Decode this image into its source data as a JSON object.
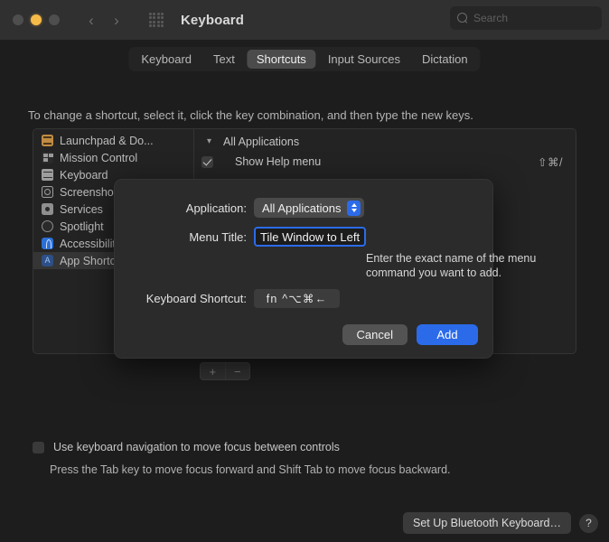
{
  "window": {
    "title": "Keyboard",
    "traffic_lights": [
      "close",
      "minimize",
      "zoom"
    ],
    "nav_back": "‹",
    "nav_forward": "›",
    "grid_icon": "grid-icon"
  },
  "search": {
    "placeholder": "Search",
    "value": "",
    "icon": "search-icon"
  },
  "tabs": [
    {
      "label": "Keyboard",
      "selected": false
    },
    {
      "label": "Text",
      "selected": false
    },
    {
      "label": "Shortcuts",
      "selected": true
    },
    {
      "label": "Input Sources",
      "selected": false
    },
    {
      "label": "Dictation",
      "selected": false
    }
  ],
  "hint": "To change a shortcut, select it, click the key combination, and then type the new keys.",
  "sidebar": {
    "items": [
      {
        "label": "Launchpad & Do...",
        "icon": "launchpad-icon",
        "selected": false
      },
      {
        "label": "Mission Control",
        "icon": "mission-control-icon",
        "selected": false
      },
      {
        "label": "Keyboard",
        "icon": "keyboard-icon",
        "selected": false
      },
      {
        "label": "Screenshots",
        "icon": "screenshot-icon",
        "selected": false
      },
      {
        "label": "Services",
        "icon": "services-icon",
        "selected": false
      },
      {
        "label": "Spotlight",
        "icon": "spotlight-icon",
        "selected": false
      },
      {
        "label": "Accessibility",
        "icon": "accessibility-icon",
        "selected": false
      },
      {
        "label": "App Shortcuts",
        "icon": "app-shortcuts-icon",
        "selected": true
      }
    ]
  },
  "shortcut_list": {
    "group": {
      "label": "All Applications",
      "expanded": true,
      "chevron": "▾"
    },
    "items": [
      {
        "label": "Show Help menu",
        "keys": "⇧⌘/",
        "checked": true
      }
    ]
  },
  "list_controls": {
    "add": "+",
    "remove": "−"
  },
  "keyboard_navigation": {
    "label": "Use keyboard navigation to move focus between controls",
    "checked": false,
    "description": "Press the Tab key to move focus forward and Shift Tab to move focus backward."
  },
  "bottom_bar": {
    "bluetooth_button": "Set Up Bluetooth Keyboard…",
    "help_button": "?"
  },
  "dialog": {
    "application": {
      "label": "Application:",
      "value": "All Applications"
    },
    "menu_title": {
      "label": "Menu Title:",
      "value": "Tile Window to Left",
      "placeholder": ""
    },
    "helper_text": "Enter the exact name of the menu command you want to add.",
    "keyboard_shortcut": {
      "label": "Keyboard Shortcut:",
      "value": "fn ^⌥⌘←"
    },
    "cancel_button": "Cancel",
    "add_button": "Add"
  },
  "colors": {
    "accent": "#2b6bea",
    "window_bg": "#1d1d1d",
    "titlebar_bg": "#303030",
    "sheet_bg": "#2b2b2b",
    "amber_light": "#f6ba49"
  }
}
